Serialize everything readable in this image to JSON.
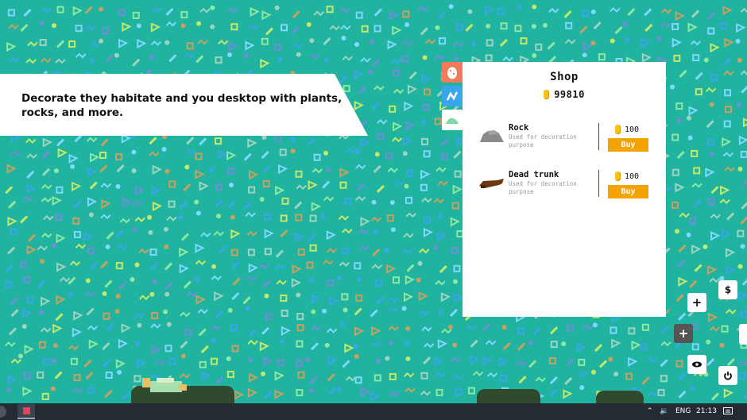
{
  "banner": {
    "text": "Decorate they habitate and you desktop with plants, rocks, and more."
  },
  "tabs": [
    {
      "name": "eggs",
      "icon": "egg-icon",
      "color": "#f07a5a"
    },
    {
      "name": "stats",
      "icon": "stats-icon",
      "color": "#3aa6ea"
    },
    {
      "name": "shop",
      "icon": "hill-icon",
      "color": "#ffffff"
    }
  ],
  "shop": {
    "title": "Shop",
    "balance": "99810",
    "items": [
      {
        "name": "Rock",
        "description": "Used for decoration purpose",
        "price": "100",
        "buy_label": "Buy"
      },
      {
        "name": "Dead trunk",
        "description": "Used for decoration purpose",
        "price": "100",
        "buy_label": "Buy"
      }
    ]
  },
  "side_buttons": {
    "dollar": "$",
    "add": "+",
    "add_dark": "+",
    "eye": "eye-icon",
    "power": "power-icon"
  },
  "taskbar": {
    "language": "ENG",
    "time": "21:13"
  },
  "colors": {
    "background": "#1fb3a0",
    "buy_button": "#f5a300",
    "coin": "#f7c218",
    "taskbar": "#252b33"
  }
}
